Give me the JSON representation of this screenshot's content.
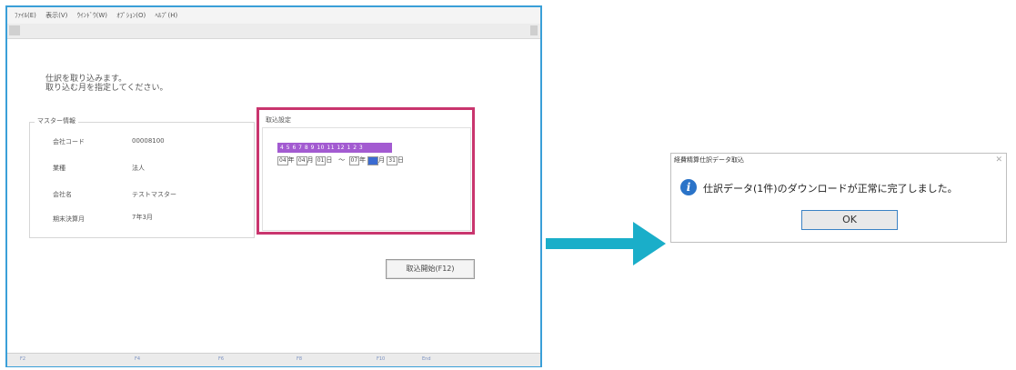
{
  "app": {
    "menu": [
      "ﾌｧｲﾙ(E)",
      "表示(V)",
      "ｳｲﾝﾄﾞｳ(W)",
      "ｵﾌﾟｼｮﾝ(O)",
      "ﾍﾙﾌﾟ(H)"
    ],
    "message_line1": "仕訳を取り込みます。",
    "message_line2": "取り込む月を指定してください。",
    "master": {
      "legend": "マスター情報",
      "rows": [
        {
          "label": "会社コード",
          "value": "00008100"
        },
        {
          "label": "業種",
          "value": "法人"
        },
        {
          "label": "会社名",
          "value": "テストマスター"
        },
        {
          "label": "期末決算月",
          "value": "7年3月"
        }
      ]
    },
    "import_settings": {
      "legend": "取込設定",
      "months": "4 5 6 7 8 9 10 11 12 1 2 3",
      "start_year": "04",
      "year_label": "年",
      "start_month": "04",
      "month_label": "月",
      "start_day": "01",
      "day_label": "日",
      "tilde": "～",
      "end_year": "07",
      "end_month": "03",
      "end_day": "31"
    },
    "start_button": "取込開始(F12)",
    "fkeys": [
      "F2",
      "F4",
      "F6",
      "F8",
      "F10",
      "End"
    ]
  },
  "dialog": {
    "title": "経費精算仕訳データ取込",
    "message": "仕訳データ(1件)のダウンロードが正常に完了しました。",
    "ok": "OK",
    "icon": "info-icon"
  },
  "colors": {
    "highlight": "#c9356e",
    "arrow": "#1aaec9",
    "window_border": "#3a9fd8",
    "month_bar": "#a35bd1"
  }
}
